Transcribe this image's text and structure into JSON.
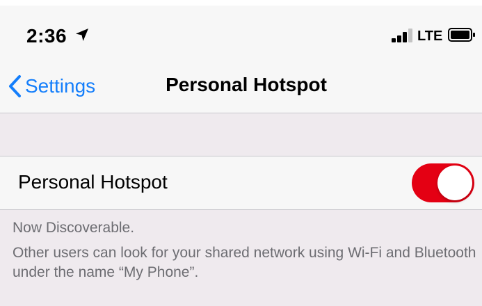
{
  "status_bar": {
    "time": "2:36",
    "carrier": "LTE",
    "icons": [
      "location-arrow-icon",
      "signal-icon",
      "battery-icon"
    ]
  },
  "nav": {
    "back_label": "Settings",
    "title": "Personal Hotspot"
  },
  "hotspot_row": {
    "label": "Personal Hotspot",
    "toggle_on": true
  },
  "footer": {
    "status": "Now Discoverable.",
    "description": "Other users can look for your shared network using Wi-Fi and Bluetooth under the name “My Phone”."
  },
  "colors": {
    "accent": "#147efb",
    "toggle_on": "#e40013",
    "background": "#efeaee",
    "bar": "#f7f7f7",
    "secondary_text": "#6d6d72"
  }
}
